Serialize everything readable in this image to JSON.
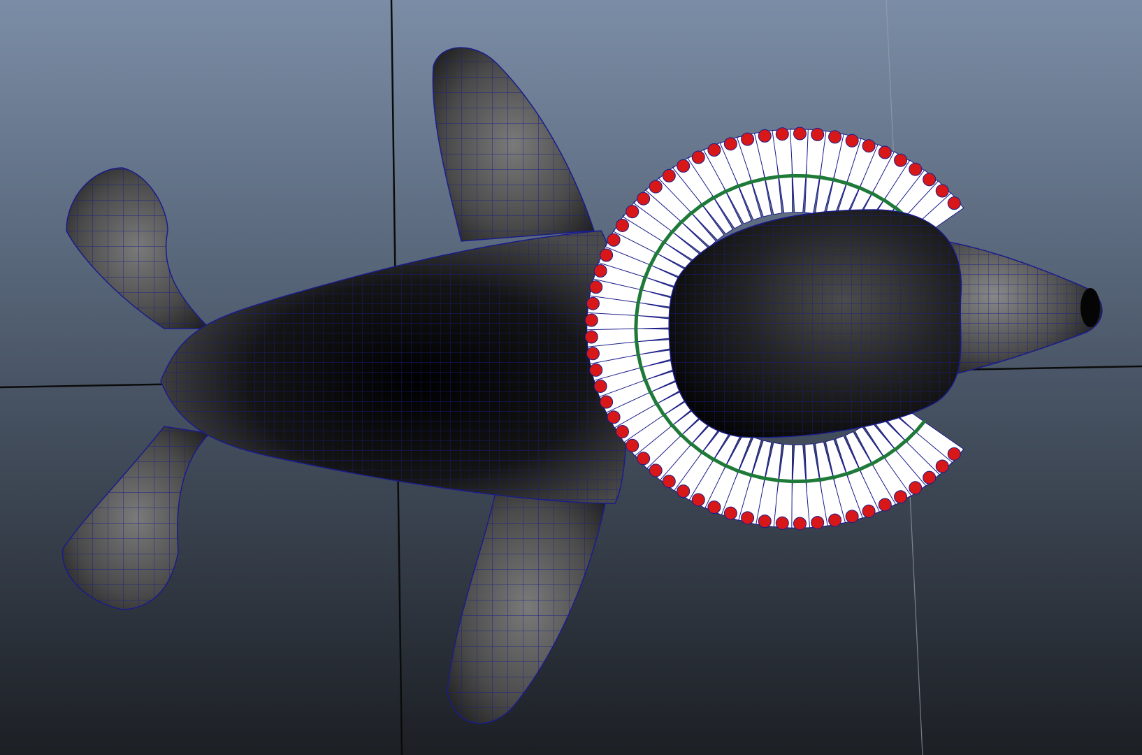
{
  "viewport": {
    "background_top": "#7b8da6",
    "background_bottom": "#1c1f24",
    "grid_axis_color": "#0a0a0a",
    "model": {
      "surface_shade": "#2a2a2a",
      "wire_color": "#1a1c8a"
    },
    "collar": {
      "spike_fill": "#ffffff",
      "tip_color": "#d81818",
      "band_color": "#1f7a3a"
    }
  }
}
